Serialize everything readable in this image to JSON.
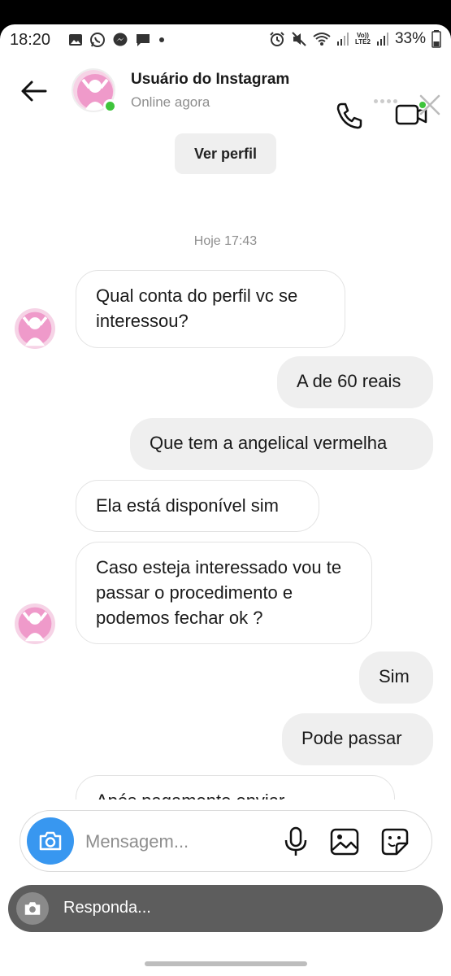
{
  "status_bar": {
    "time": "18:20",
    "battery": "33%",
    "network_label_top": "Vo))",
    "network_label_bottom": "LTE2"
  },
  "header": {
    "contact_name": "Usuário do Instagram",
    "contact_status": "Online agora",
    "view_profile_label": "Ver perfil",
    "online_color": "#3ec43b"
  },
  "conversation": {
    "date_stamp": "Hoje 17:43",
    "messages": [
      {
        "direction": "in",
        "text": "Qual conta do perfil vc se interessou?"
      },
      {
        "direction": "out",
        "text": "A de 60 reais"
      },
      {
        "direction": "out",
        "text": "Que tem a angelical vermelha"
      },
      {
        "direction": "in",
        "text": "Ela está disponível sim"
      },
      {
        "direction": "in",
        "text": "Caso esteja interessado vou te passar o procedimento e podemos fechar ok ?"
      },
      {
        "direction": "out",
        "text": "Sim"
      },
      {
        "direction": "out",
        "text": "Pode passar"
      },
      {
        "direction": "in",
        "text": "Após pagamento enviar"
      }
    ]
  },
  "composer": {
    "placeholder": "Mensagem...",
    "accent_color": "#3897f0"
  },
  "reply_bar": {
    "label": "Responda..."
  }
}
